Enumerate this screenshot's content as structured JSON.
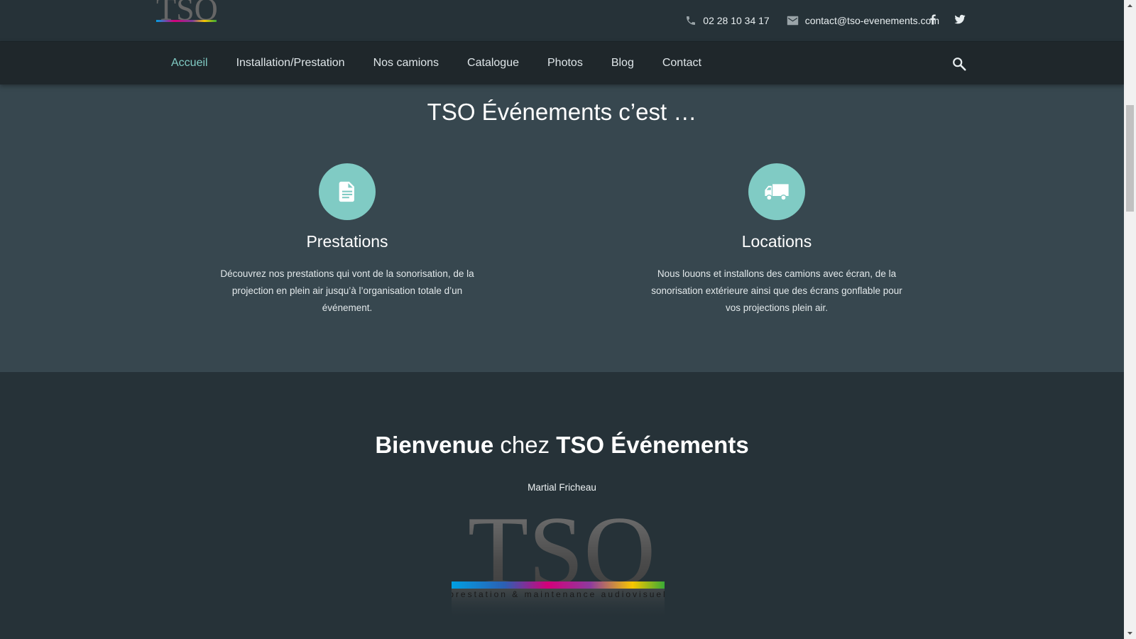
{
  "brand": {
    "logo_text": "TSO",
    "tagline": "prestation & maintenance audiovisuel"
  },
  "contact": {
    "phone": "02 28 10 34 17",
    "email": "contact@tso-evenements.com"
  },
  "nav": {
    "items": [
      {
        "label": "Accueil",
        "active": true
      },
      {
        "label": "Installation/Prestation"
      },
      {
        "label": "Nos camions"
      },
      {
        "label": "Catalogue"
      },
      {
        "label": "Photos"
      },
      {
        "label": "Blog"
      },
      {
        "label": "Contact"
      }
    ]
  },
  "intro": {
    "title": "TSO Événements c’est …"
  },
  "features": [
    {
      "icon": "document-icon",
      "title": "Prestations",
      "text": "Découvrez nos prestations qui vont de la sonorisation, de la projection en plein air jusqu’à l’organisation totale d’un événement."
    },
    {
      "icon": "truck-icon",
      "title": "Locations",
      "text": "Nous louons et installons des camions avec écran, de la sonorisation extérieure ainsi que des écrans gonflable pour vos projections plein air."
    }
  ],
  "welcome": {
    "bold1": "Bienvenue",
    "light": " chez ",
    "bold2": "TSO Événements",
    "author": "Martial Fricheau"
  },
  "colors": {
    "accent": "#80cbc4",
    "dark": "#263238",
    "section": "#37474f",
    "nav": "#1f272b"
  }
}
